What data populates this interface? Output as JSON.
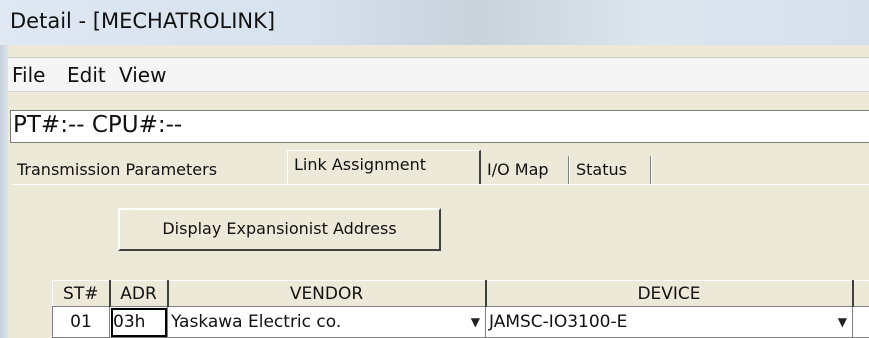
{
  "window": {
    "title": "Detail - [MECHATROLINK]"
  },
  "menu": {
    "items": [
      "File",
      "Edit",
      "View"
    ]
  },
  "status": {
    "pt_cpu": "PT#:-- CPU#:--"
  },
  "tabs": [
    {
      "label": "Transmission Parameters",
      "active": false
    },
    {
      "label": "Link Assignment",
      "active": true
    },
    {
      "label": "I/O Map",
      "active": false
    },
    {
      "label": "Status",
      "active": false
    }
  ],
  "actions": {
    "display_address_label": "Display Expansionist Address"
  },
  "table": {
    "headers": [
      "ST#",
      "ADR",
      "VENDOR",
      "DEVICE"
    ],
    "rows": [
      {
        "st": "01",
        "adr": "03h",
        "vendor": "Yaskawa Electric co.",
        "device": "JAMSC-IO3100-E"
      }
    ]
  }
}
